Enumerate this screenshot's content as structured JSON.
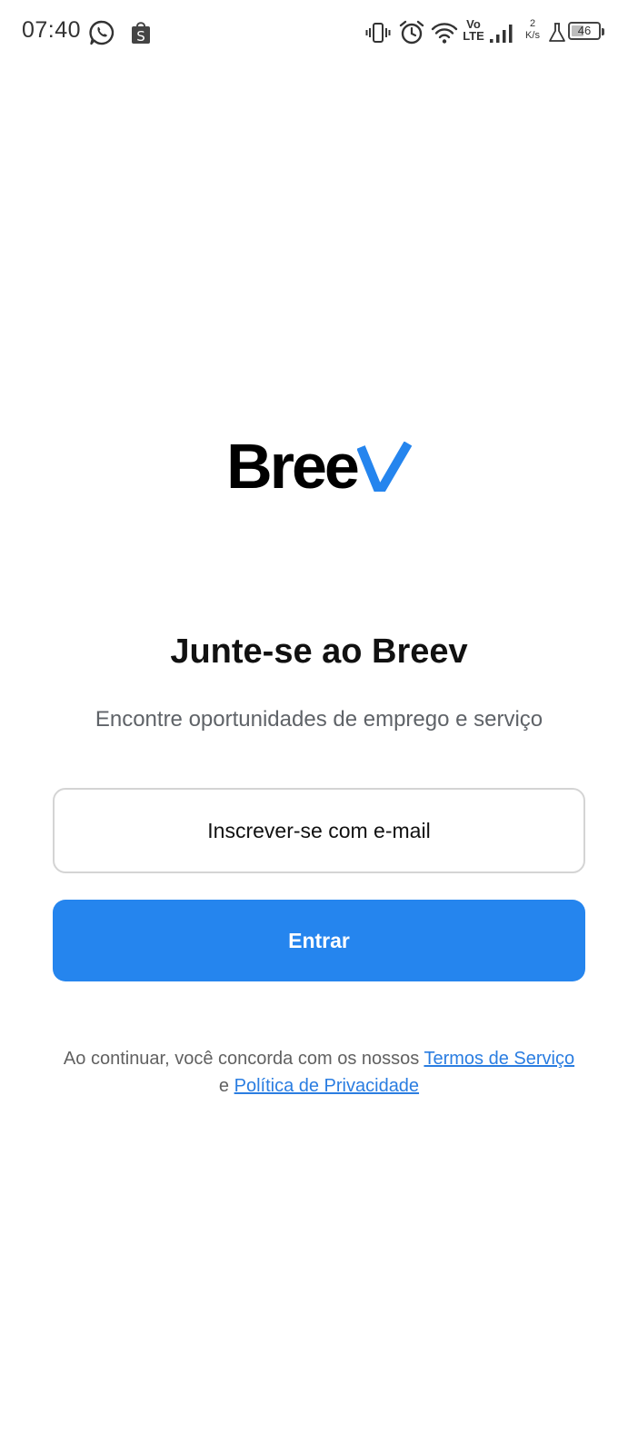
{
  "status_bar": {
    "time": "07:40",
    "network_speed_value": "2",
    "network_speed_unit": "K/s",
    "volte_top": "Vo",
    "volte_bottom": "LTE",
    "battery_level": "46",
    "battery_fraction": 0.46,
    "icons": [
      "whatsapp-icon",
      "shop-icon",
      "vibrate-icon",
      "alarm-icon",
      "wifi-icon",
      "signal-icon",
      "flask-icon",
      "battery-icon"
    ]
  },
  "logo": {
    "text": "Bree",
    "check_color": "#2585ee"
  },
  "header": {
    "title": "Junte-se ao Breev",
    "subtitle": "Encontre oportunidades de emprego e serviço"
  },
  "actions": {
    "email_signup_label": "Inscrever-se com e-mail",
    "login_label": "Entrar"
  },
  "terms": {
    "prefix": "Ao continuar, você concorda com os nossos",
    "terms_link": "Termos de Serviço",
    "conjunction": "e",
    "privacy_link": "Política de Privacidade"
  },
  "colors": {
    "accent": "#2585ee",
    "link": "#2a7de1",
    "background": "#ffffff"
  }
}
